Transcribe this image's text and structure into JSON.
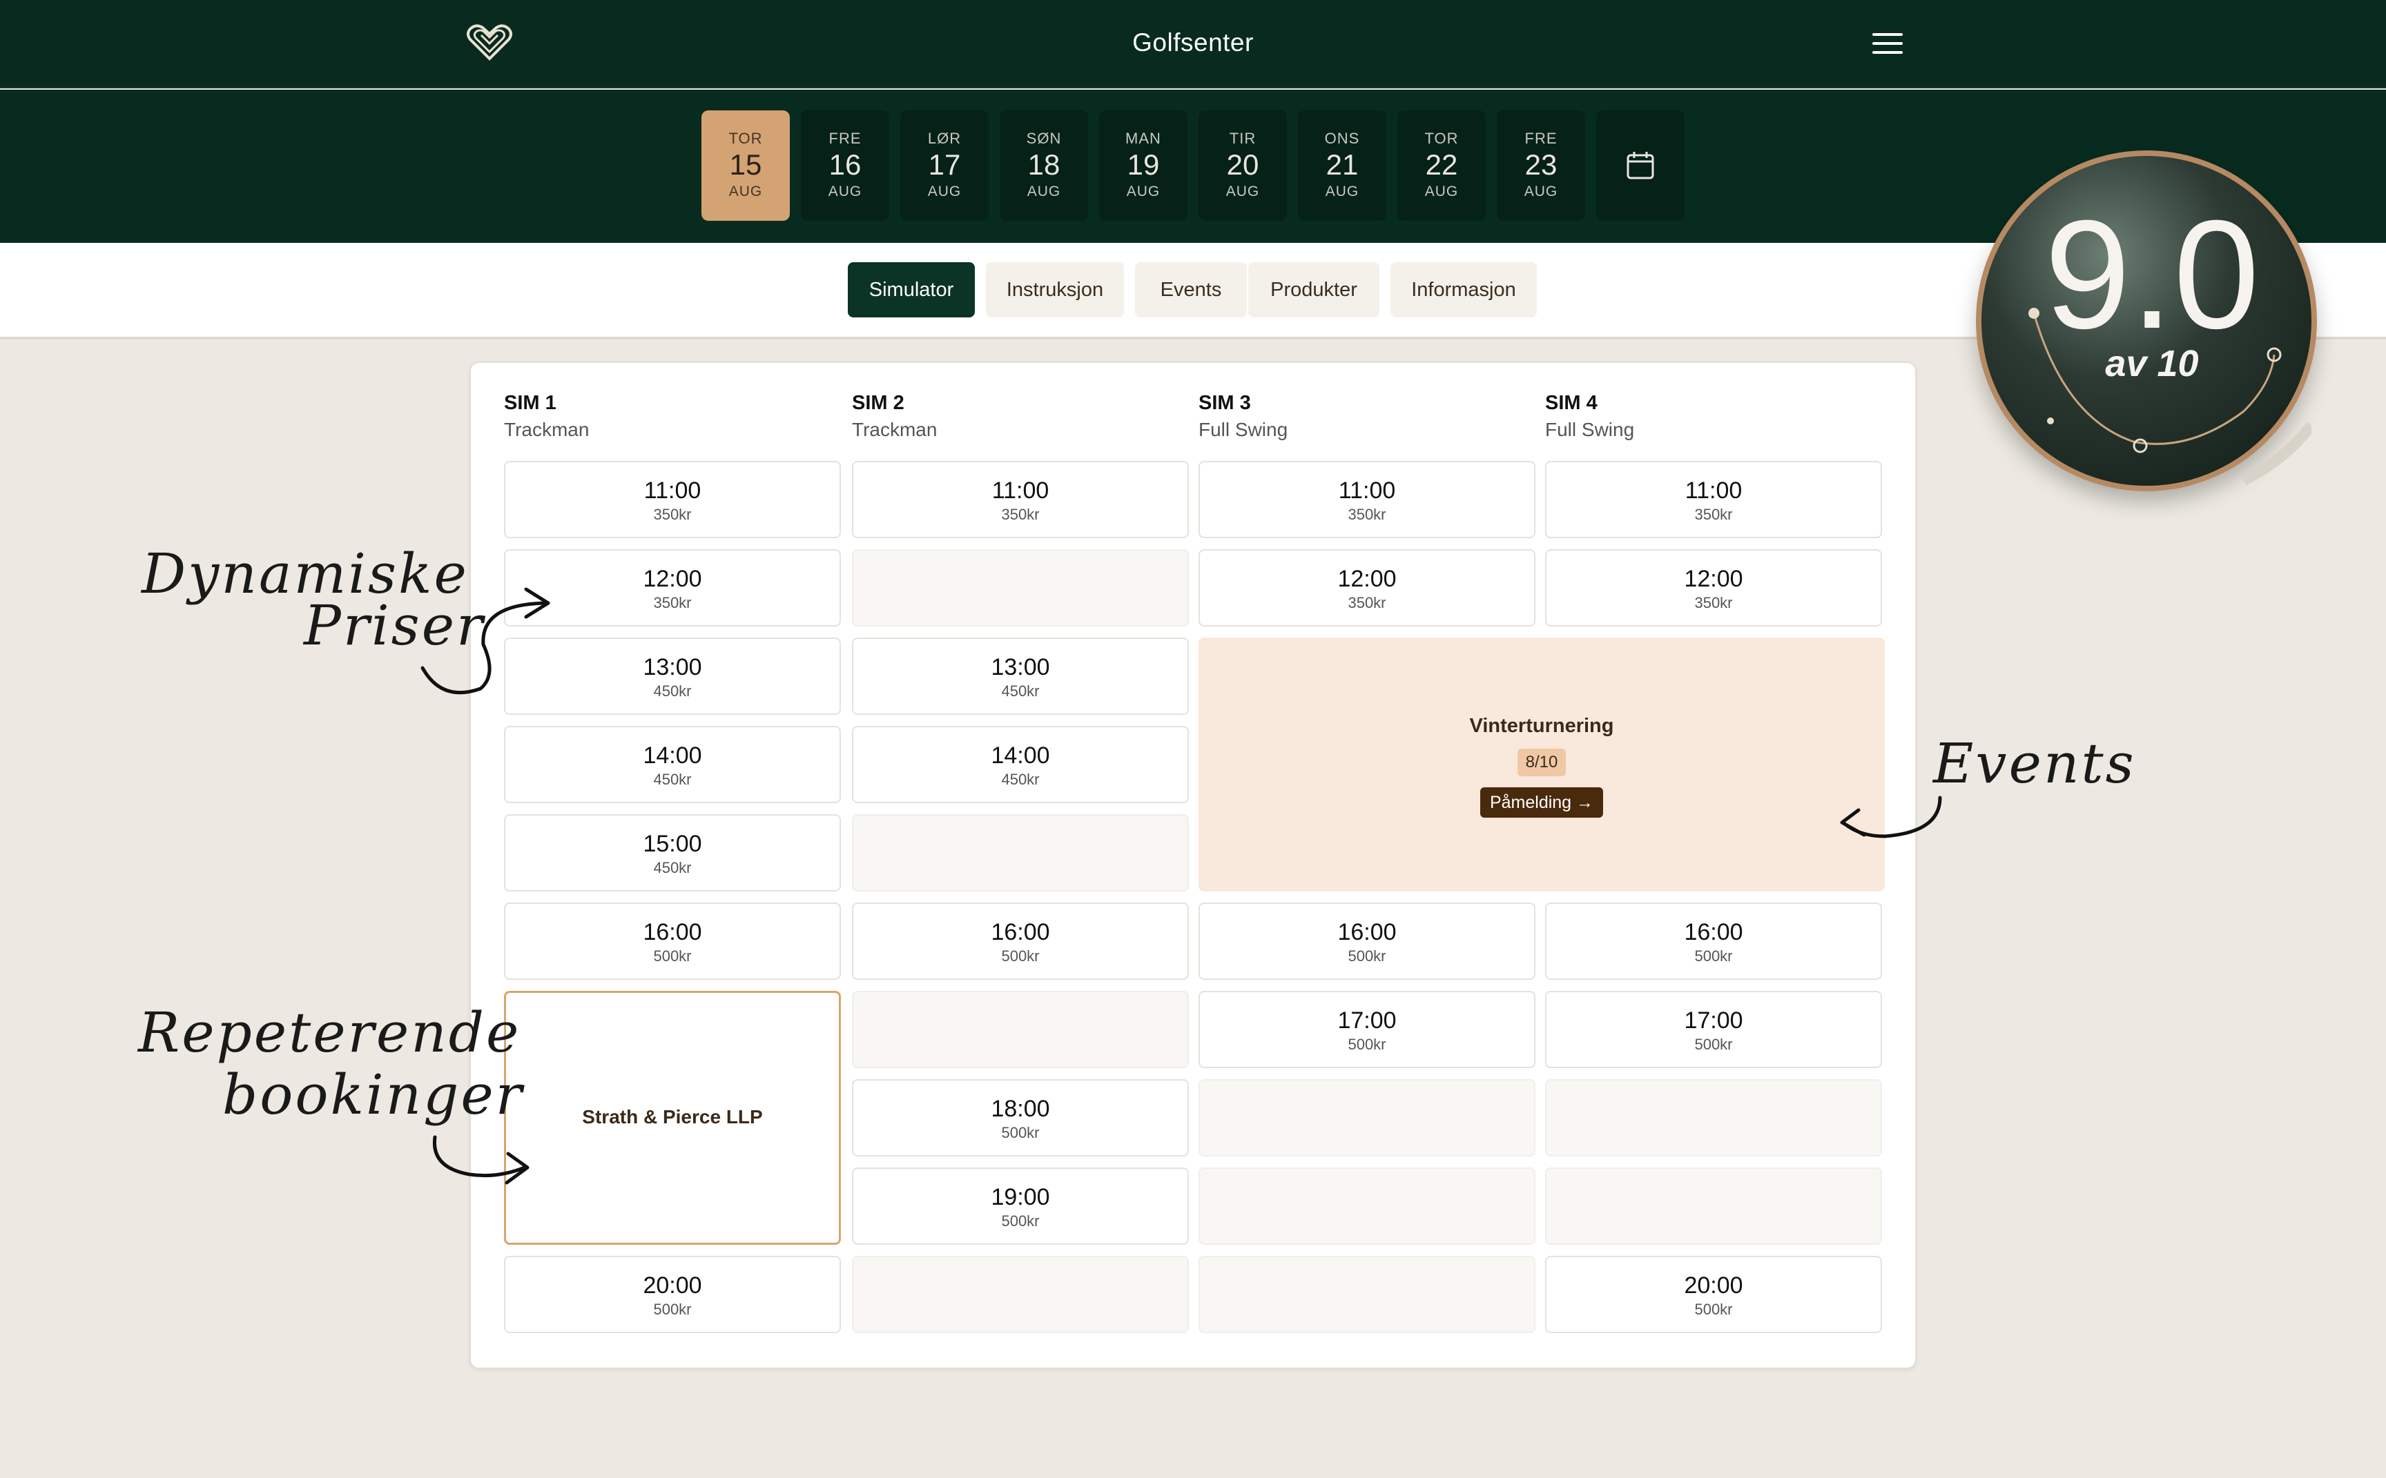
{
  "header": {
    "title": "Golfsenter",
    "logo_icon": "heart-logo-icon",
    "menu_icon": "hamburger-menu-icon"
  },
  "days": [
    {
      "dow": "TOR",
      "num": "15",
      "mon": "AUG",
      "active": true
    },
    {
      "dow": "FRE",
      "num": "16",
      "mon": "AUG"
    },
    {
      "dow": "LØR",
      "num": "17",
      "mon": "AUG"
    },
    {
      "dow": "SØN",
      "num": "18",
      "mon": "AUG"
    },
    {
      "dow": "MAN",
      "num": "19",
      "mon": "AUG"
    },
    {
      "dow": "TIR",
      "num": "20",
      "mon": "AUG"
    },
    {
      "dow": "ONS",
      "num": "21",
      "mon": "AUG"
    },
    {
      "dow": "TOR",
      "num": "22",
      "mon": "AUG"
    },
    {
      "dow": "FRE",
      "num": "23",
      "mon": "AUG"
    }
  ],
  "calendar_icon": "calendar-icon",
  "tabs": [
    {
      "label": "Simulator",
      "active": true
    },
    {
      "label": "Instruksjon"
    },
    {
      "label": "Events"
    },
    {
      "label": "Produkter"
    },
    {
      "label": "Informasjon"
    }
  ],
  "columns": [
    {
      "name": "SIM 1",
      "sub": "Trackman",
      "slots": [
        {
          "time": "11:00",
          "price": "350kr"
        },
        {
          "time": "12:00",
          "price": "350kr"
        },
        {
          "time": "13:00",
          "price": "450kr"
        },
        {
          "time": "14:00",
          "price": "450kr"
        },
        {
          "time": "15:00",
          "price": "450kr"
        },
        {
          "time": "16:00",
          "price": "500kr"
        },
        null,
        null,
        null,
        {
          "time": "20:00",
          "price": "500kr"
        }
      ]
    },
    {
      "name": "SIM 2",
      "sub": "Trackman",
      "slots": [
        {
          "time": "11:00",
          "price": "350kr"
        },
        null,
        {
          "time": "13:00",
          "price": "450kr"
        },
        {
          "time": "14:00",
          "price": "450kr"
        },
        null,
        {
          "time": "16:00",
          "price": "500kr"
        },
        null,
        {
          "time": "18:00",
          "price": "500kr"
        },
        {
          "time": "19:00",
          "price": "500kr"
        },
        null
      ]
    },
    {
      "name": "SIM 3",
      "sub": "Full Swing",
      "slots": [
        {
          "time": "11:00",
          "price": "350kr"
        },
        {
          "time": "12:00",
          "price": "350kr"
        },
        null,
        null,
        null,
        {
          "time": "16:00",
          "price": "500kr"
        },
        {
          "time": "17:00",
          "price": "500kr"
        },
        null,
        null,
        null
      ]
    },
    {
      "name": "SIM 4",
      "sub": "Full Swing",
      "slots": [
        {
          "time": "11:00",
          "price": "350kr"
        },
        {
          "time": "12:00",
          "price": "350kr"
        },
        null,
        null,
        null,
        {
          "time": "16:00",
          "price": "500kr"
        },
        {
          "time": "17:00",
          "price": "500kr"
        },
        null,
        null,
        {
          "time": "20:00",
          "price": "500kr"
        }
      ]
    }
  ],
  "event": {
    "title": "Vinterturnering",
    "count": "8/10",
    "signup": "Påmelding →"
  },
  "recurring_booking": {
    "label": "Strath & Pierce LLP"
  },
  "annotations": {
    "dynamic_line1": "Dynamiske",
    "dynamic_line2": "Priser",
    "events": "Events",
    "recurring_line1": "Repeterende",
    "recurring_line2": "bookinger"
  },
  "badge": {
    "score": "9.0",
    "of": "av 10"
  },
  "colors": {
    "header_bg": "#092A1F",
    "active_day": "#D4A373",
    "active_tab": "#0B3326",
    "event_bg": "#F9E8DC",
    "recurring_border": "#D8A470",
    "page_bg": "#EDE9E2"
  }
}
